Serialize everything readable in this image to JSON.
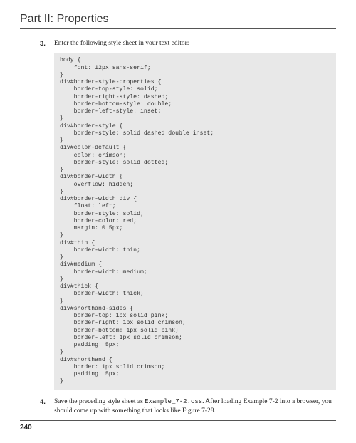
{
  "header": {
    "title": "Part II: Properties"
  },
  "steps": [
    {
      "number": "3.",
      "text": "Enter the following style sheet in your text editor:"
    },
    {
      "number": "4.",
      "text_before": "Save the preceding style sheet as ",
      "code": "Example_7-2.css",
      "text_after": ". After loading Example 7-2 into a browser, you should come up with something that looks like Figure 7-28."
    }
  ],
  "code_block": "body {\n    font: 12px sans-serif;\n}\ndiv#border-style-properties {\n    border-top-style: solid;\n    border-right-style: dashed;\n    border-bottom-style: double;\n    border-left-style: inset;\n}\ndiv#border-style {\n    border-style: solid dashed double inset;\n}\ndiv#color-default {\n    color: crimson;\n    border-style: solid dotted;\n}\ndiv#border-width {\n    overflow: hidden;\n}\ndiv#border-width div {\n    float: left;\n    border-style: solid;\n    border-color: red;\n    margin: 0 5px;\n}\ndiv#thin {\n    border-width: thin;\n}\ndiv#medium {\n    border-width: medium;\n}\ndiv#thick {\n    border-width: thick;\n}\ndiv#shorthand-sides {\n    border-top: 1px solid pink;\n    border-right: 1px solid crimson;\n    border-bottom: 1px solid pink;\n    border-left: 1px solid crimson;\n    padding: 5px;\n}\ndiv#shorthand {\n    border: 1px solid crimson;\n    padding: 5px;\n}",
  "page_number": "240"
}
